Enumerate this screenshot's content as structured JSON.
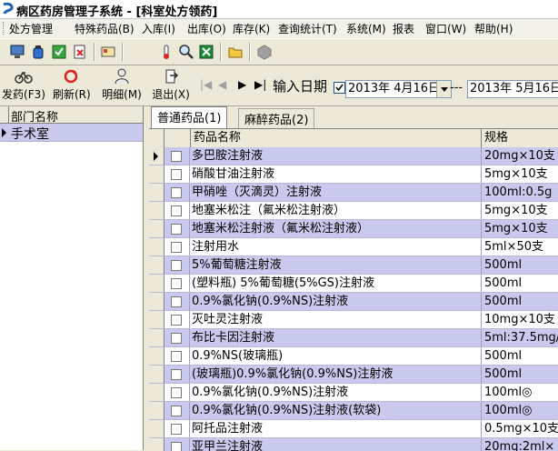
{
  "window": {
    "title": "病区药房管理子系统 - [科室处方领药]"
  },
  "menu": {
    "items": [
      "处方管理",
      "特殊药品(B)",
      "入库(I)",
      "出库(O)",
      "库存(K)",
      "查询统计(T)",
      "系统(M)",
      "报表",
      "窗口(W)",
      "帮助(H)"
    ]
  },
  "toolbar": {
    "issue_label": "发药(F3)",
    "refresh_label": "刷新(R)",
    "detail_label": "明细(M)",
    "exit_label": "退出(X)",
    "date_label": "输入日期",
    "date_checked": true,
    "date_from": "2013年 4月16日",
    "date_sep": "---",
    "date_to": "2013年 5月16日"
  },
  "departments": {
    "header": "部门名称",
    "rows": [
      "手术室"
    ]
  },
  "tabs": {
    "normal_label": "普通药品(1)",
    "narcotic_label": "麻醉药品(2)"
  },
  "grid": {
    "columns": {
      "name": "药品名称",
      "spec": "规格"
    },
    "rows": [
      {
        "name": "多巴胺注射液",
        "spec": "20mg×10支"
      },
      {
        "name": "硝酸甘油注射液",
        "spec": "5mg×10支"
      },
      {
        "name": "甲硝唑（灭滴灵）注射液",
        "spec": "100ml:0.5g"
      },
      {
        "name": "地塞米松注（氟米松注射液）",
        "spec": "5mg×10支"
      },
      {
        "name": "地塞米松注射液（氟米松注射液）",
        "spec": "5mg×10支"
      },
      {
        "name": "注射用水",
        "spec": "5ml×50支"
      },
      {
        "name": "5%葡萄糖注射液",
        "spec": "500ml"
      },
      {
        "name": "(塑料瓶) 5%葡萄糖(5%GS)注射液",
        "spec": "500ml"
      },
      {
        "name": "0.9%氯化钠(0.9%NS)注射液",
        "spec": "500ml"
      },
      {
        "name": "灭吐灵注射液",
        "spec": "10mg×10支"
      },
      {
        "name": "布比卡因注射液",
        "spec": "5ml:37.5mg/"
      },
      {
        "name": "0.9%NS(玻璃瓶)",
        "spec": "500ml"
      },
      {
        "name": "(玻璃瓶)0.9%氯化钠(0.9%NS)注射液",
        "spec": "500ml"
      },
      {
        "name": "0.9%氯化钠(0.9%NS)注射液",
        "spec": "100ml◎"
      },
      {
        "name": "0.9%氯化钠(0.9%NS)注射液(软袋)",
        "spec": "100ml◎"
      },
      {
        "name": "阿托品注射液",
        "spec": "0.5mg×10支"
      },
      {
        "name": "亚甲兰注射液",
        "spec": "20mg:2ml×"
      }
    ]
  },
  "colors": {
    "row_alt": "#c9c9ee",
    "chrome": "#ece9d8"
  }
}
